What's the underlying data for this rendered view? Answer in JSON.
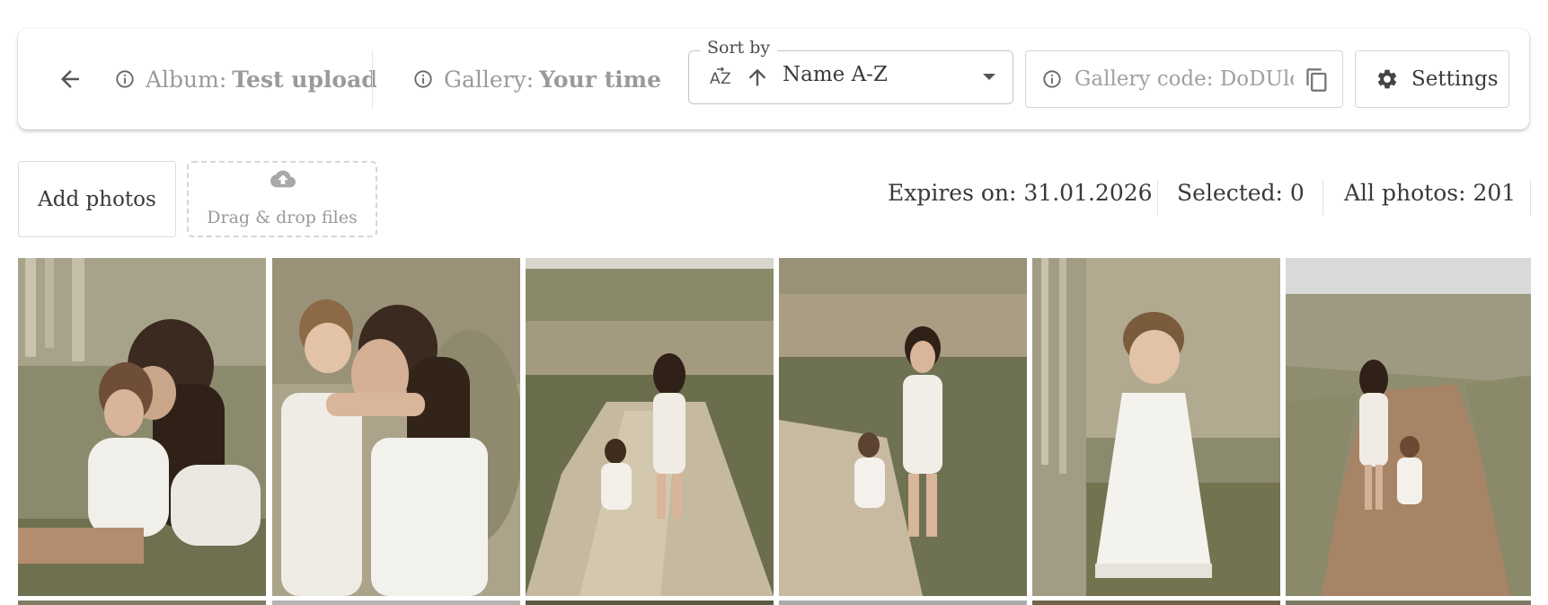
{
  "toolbar": {
    "album_label": "Album:",
    "album_name": "Test upload",
    "gallery_label": "Gallery:",
    "gallery_name": "Your time",
    "sort": {
      "legend": "Sort by",
      "value": "Name A-Z",
      "direction": "ascending"
    },
    "gallery_code_text": "Gallery code: DoDUlo",
    "settings_label": "Settings"
  },
  "actions": {
    "add_photos_label": "Add photos",
    "dropzone_label": "Drag & drop files"
  },
  "stats": {
    "expires": "Expires on: 31.01.2026",
    "selected": "Selected: 0",
    "all_photos": "All photos: 201"
  },
  "colors": {
    "text": "#3a3a3a",
    "muted": "#9a9a9a",
    "border": "#d6d6d6",
    "photo_tones": [
      "#8a8a6a",
      "#a19a80",
      "#6f7152",
      "#77775a",
      "#9d9880",
      "#8f8d72"
    ]
  },
  "icons": {
    "back": "arrow-left-icon",
    "info": "info-icon",
    "sort_alpha": "sort-alpha-icon",
    "sort_direction": "arrow-up-icon",
    "dropdown": "caret-down-icon",
    "copy": "copy-icon",
    "settings": "gear-icon",
    "upload": "cloud-upload-icon"
  }
}
